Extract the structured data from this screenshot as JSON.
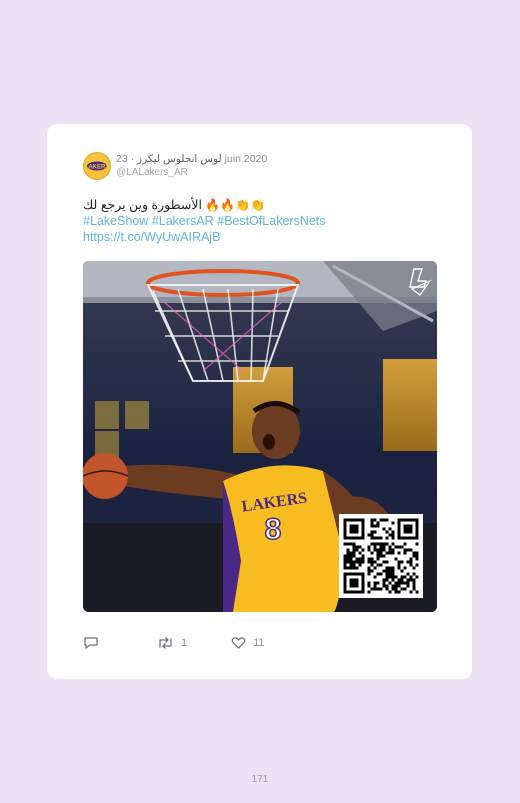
{
  "tweet": {
    "display_name": "لوس انجلوس ليكرز",
    "separator": "·",
    "date": "23 juin 2020",
    "handle": "@LALakers_AR",
    "text_arabic": "الأسطورة وين يرجع لك",
    "text_emoji": "🔥🔥👏👏",
    "hashtags": [
      "#LakeShow",
      "#LakersAR",
      "#BestOfLakersNets"
    ],
    "link": "https://t.co/WyUwAIRAjB",
    "jersey_text": "LAKERS",
    "jersey_number": "8",
    "retweets": "1",
    "likes": "11"
  },
  "icons": {
    "reply": "reply-icon",
    "retweet": "retweet-icon",
    "like": "heart-icon",
    "media_logo": "lakers-logo-icon"
  },
  "colors": {
    "background": "#ede2f5",
    "link": "#5fb3e6",
    "lakers_gold": "#f5c23a",
    "lakers_purple": "#4b2a87"
  },
  "page_number": "171"
}
